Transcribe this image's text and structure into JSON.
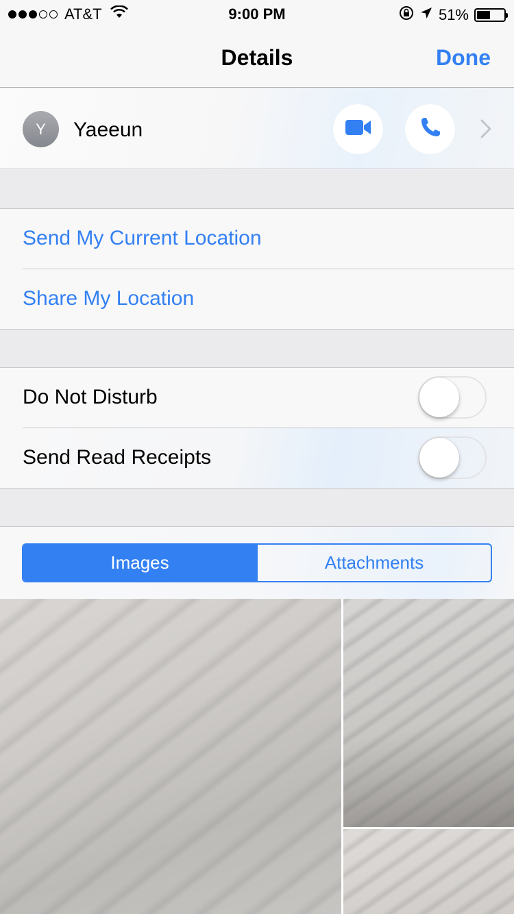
{
  "status_bar": {
    "carrier": "AT&T",
    "time": "9:00 PM",
    "battery_percent": "51%",
    "battery_level": 0.51,
    "signal_dots_filled": 3,
    "signal_dots_total": 5
  },
  "nav": {
    "title": "Details",
    "done_label": "Done"
  },
  "contact": {
    "initial": "Y",
    "name": "Yaeeun",
    "icons": [
      "video-icon",
      "phone-icon",
      "chevron-right-icon"
    ]
  },
  "location": {
    "send_current": "Send My Current Location",
    "share": "Share My Location"
  },
  "settings": {
    "do_not_disturb": {
      "label": "Do Not Disturb",
      "on": false
    },
    "read_receipts": {
      "label": "Send Read Receipts",
      "on": false
    }
  },
  "segments": {
    "items": [
      "Images",
      "Attachments"
    ],
    "selected": "Images"
  },
  "colors": {
    "accent": "#3380f2"
  }
}
